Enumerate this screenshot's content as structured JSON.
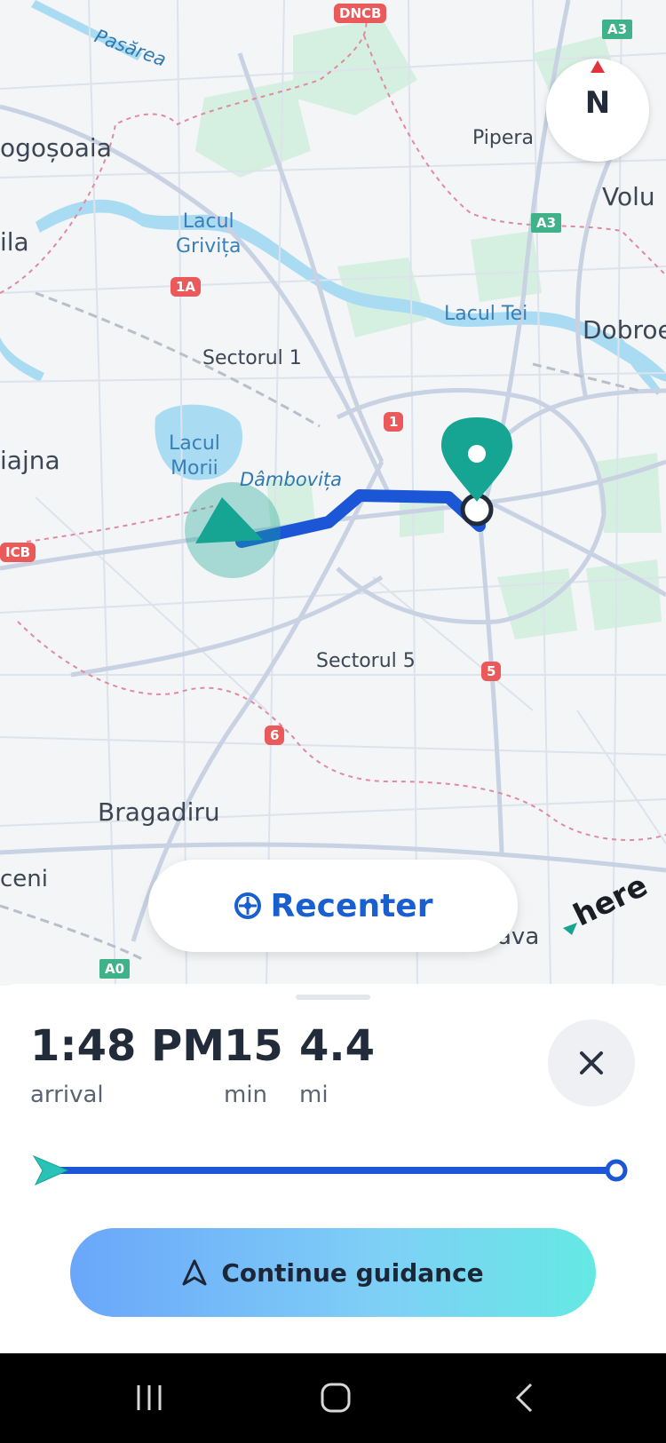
{
  "map": {
    "labels": {
      "pasarea": "Pasărea",
      "mogosoaia": "ogoșoaia",
      "pipera": "Pipera",
      "voluntari": "Volu",
      "chitila": "ila",
      "lacul_grivita": "Lacul\nGrivița",
      "lacul_tei": "Lacul Tei",
      "dobroesti": "Dobroe",
      "sectorul1": "Sectorul 1",
      "militari": "iajna",
      "lacul_morii": "Lacul\nMorii",
      "dambovita": "Dâmbovița",
      "sectorul5": "Sectorul 5",
      "bragadiru": "Bragadiru",
      "ceni": "ceni",
      "va": "ava"
    },
    "shields": {
      "dncb_top": "DNCB",
      "a3_top": "A3",
      "a3_mid": "A3",
      "r1a": "1A",
      "r1": "1",
      "dncb_left": "ICB",
      "r5": "5",
      "r6": "6",
      "a0": "A0"
    },
    "compass_label": "N",
    "recenter_label": "Recenter",
    "brand": "here",
    "colors": {
      "route": "#1a56d6",
      "teal": "#17a593",
      "water": "#a9dcf3",
      "park": "#cdeedd"
    }
  },
  "trip": {
    "arrival_time": "1:48 PM",
    "arrival_label": "arrival",
    "duration": "15",
    "duration_unit": "min",
    "distance": "4.4",
    "distance_unit": "mi",
    "progress": 0.0
  },
  "actions": {
    "continue_label": "Continue guidance"
  },
  "icons": {
    "close": "close-icon",
    "recenter": "crosshair-icon",
    "navigation": "navigation-arrow-icon",
    "destination": "destination-pin-icon"
  }
}
